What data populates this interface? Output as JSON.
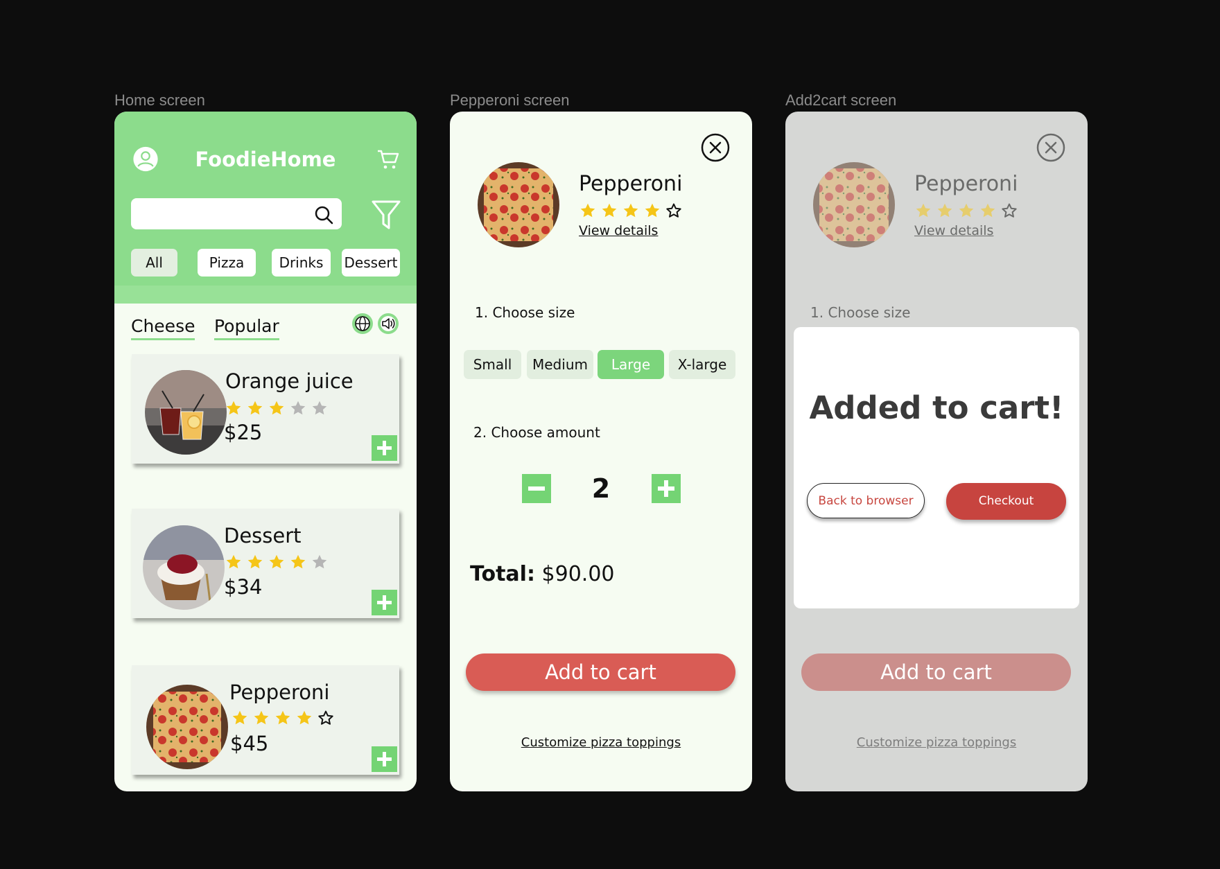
{
  "frames": {
    "home_label": "Home screen",
    "pepperoni_label": "Pepperoni screen",
    "add2cart_label": "Add2cart screen"
  },
  "colors": {
    "brand_green": "#8cdc8c",
    "accent_red": "#d95c55",
    "star_yellow": "#f5c518",
    "star_gray": "#b5b5b5"
  },
  "home": {
    "title": "FoodieHome",
    "icons": [
      "user-icon",
      "cart-icon",
      "search-icon",
      "filter-icon",
      "globe-icon",
      "speaker-icon"
    ],
    "search": {
      "value": "",
      "placeholder": ""
    },
    "chips": [
      {
        "label": "All",
        "active": true
      },
      {
        "label": "Pizza",
        "active": false
      },
      {
        "label": "Drinks",
        "active": false
      },
      {
        "label": "Dessert",
        "active": false
      }
    ],
    "tabs": [
      {
        "label": "Cheese"
      },
      {
        "label": "Popular"
      }
    ],
    "items": [
      {
        "name": "Orange juice",
        "rating": 3,
        "price": "$25"
      },
      {
        "name": "Dessert",
        "rating": 4,
        "price": "$34"
      },
      {
        "name": "Pepperoni",
        "rating": 4,
        "price": "$45"
      }
    ]
  },
  "product": {
    "name": "Pepperoni",
    "rating": 4,
    "view_details": "View details",
    "size_label": "1. Choose size",
    "sizes": [
      {
        "label": "Small",
        "selected": false
      },
      {
        "label": "Medium",
        "selected": false
      },
      {
        "label": "Large",
        "selected": true
      },
      {
        "label": "X-large",
        "selected": false
      }
    ],
    "amount_label": "2. Choose amount",
    "amount": "2",
    "total_label": "Total:",
    "total_value": "$90.00",
    "add_to_cart": "Add to cart",
    "customize": "Customize pizza toppings"
  },
  "cart_modal": {
    "title": "Added to cart!",
    "back_button": "Back to browser",
    "checkout_button": "Checkout"
  }
}
